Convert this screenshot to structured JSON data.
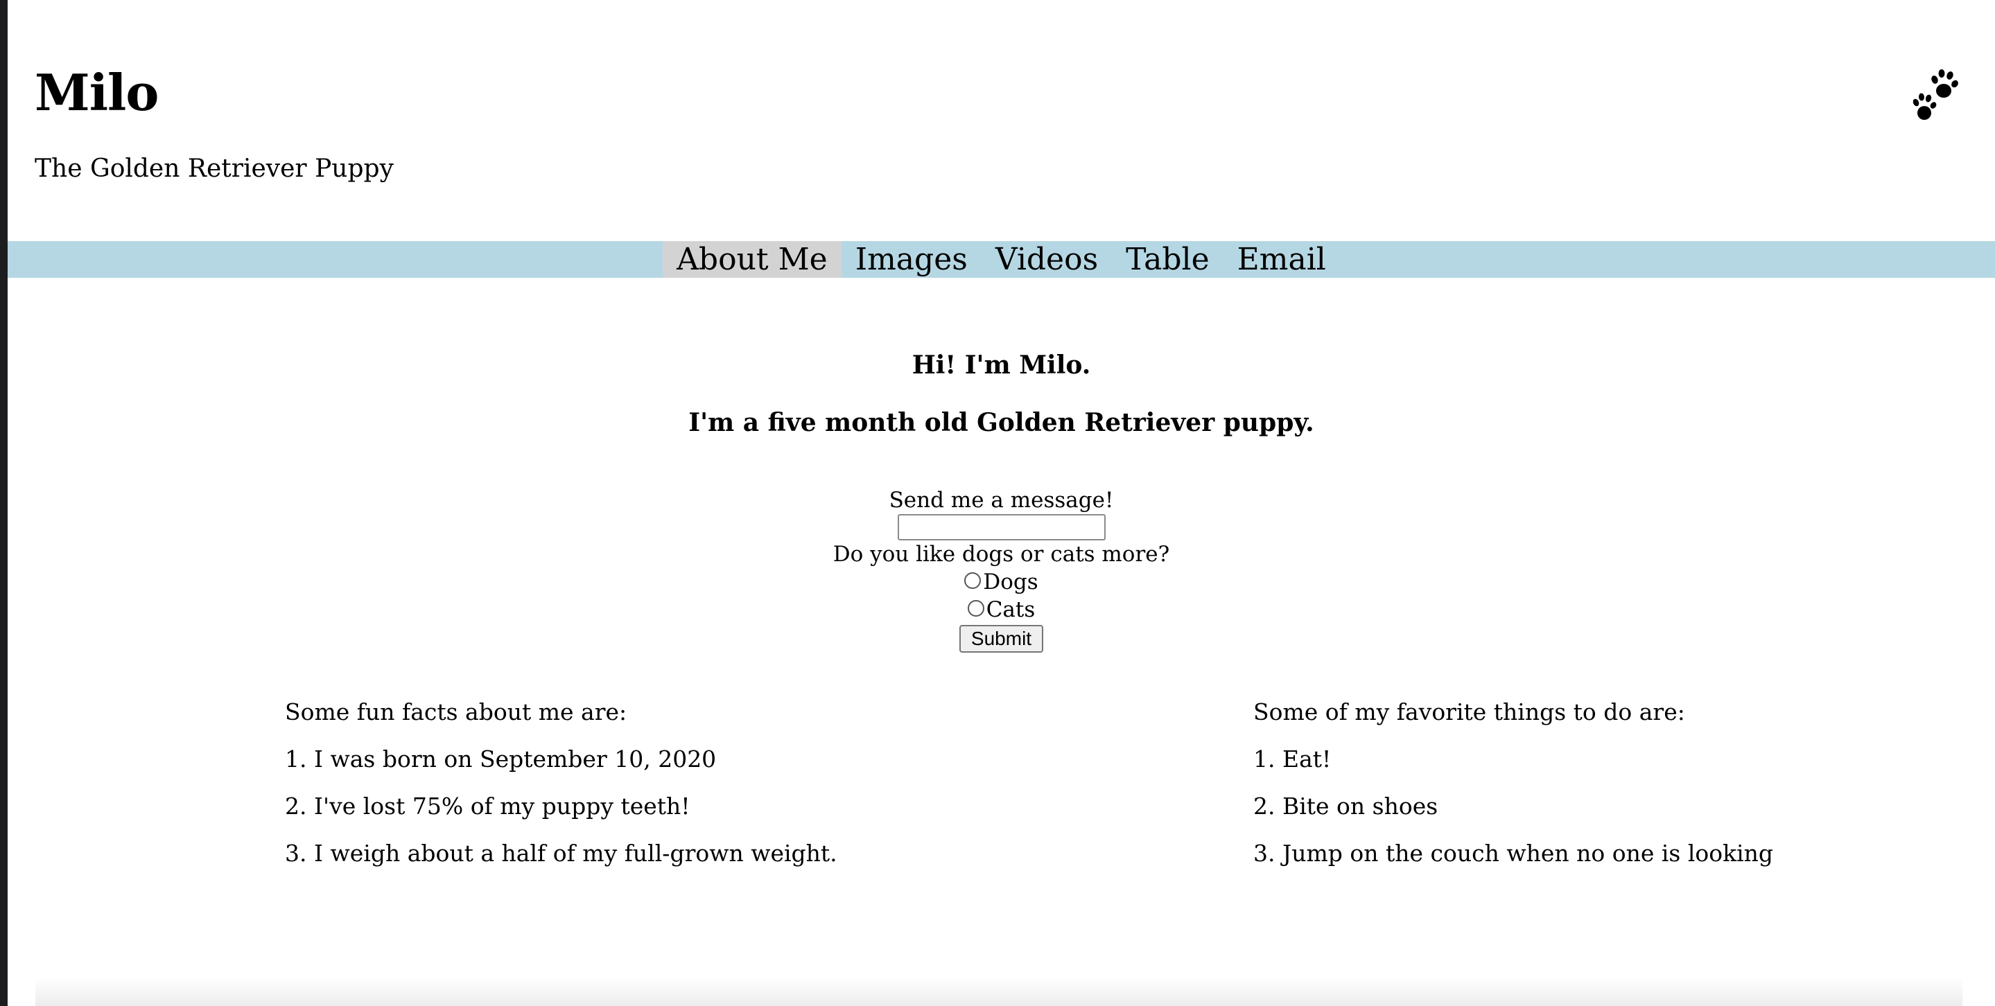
{
  "header": {
    "title": "Milo",
    "subtitle": "The Golden Retriever Puppy",
    "logo_icon": "paw-prints-icon"
  },
  "nav": {
    "items": [
      {
        "label": "About Me",
        "active": true
      },
      {
        "label": "Images",
        "active": false
      },
      {
        "label": "Videos",
        "active": false
      },
      {
        "label": "Table",
        "active": false
      },
      {
        "label": "Email",
        "active": false
      }
    ]
  },
  "intro": {
    "greeting": "Hi! I'm Milo.",
    "description": "I'm a five month old Golden Retriever puppy."
  },
  "form": {
    "message_label": "Send me a message!",
    "message_value": "",
    "question": "Do you like dogs or cats more?",
    "options": [
      "Dogs",
      "Cats"
    ],
    "submit_label": "Submit"
  },
  "facts": {
    "heading": "Some fun facts about me are:",
    "items": [
      "1. I was born on September 10, 2020",
      "2. I've lost 75% of my puppy teeth!",
      "3. I weigh about a half of my full-grown weight."
    ]
  },
  "favorites": {
    "heading": "Some of my favorite things to do are:",
    "items": [
      "1. Eat!",
      "2. Bite on shoes",
      "3. Jump on the couch when no one is looking"
    ]
  },
  "colors": {
    "nav_background": "#b5d7e3",
    "nav_active": "#d3d3d3"
  }
}
